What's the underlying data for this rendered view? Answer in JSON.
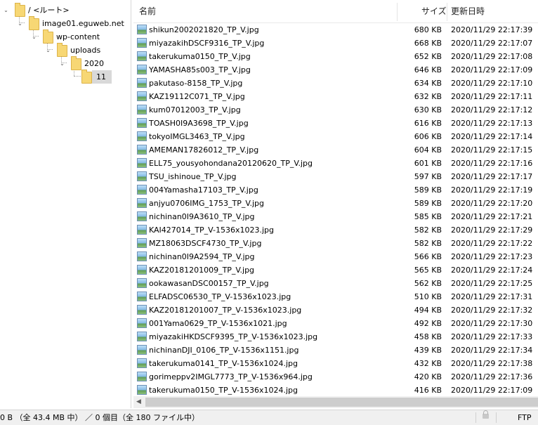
{
  "tree": [
    {
      "label": "/ <ルート>",
      "expanded": true,
      "selected": false
    },
    {
      "label": "image01.eguweb.net",
      "expanded": true,
      "selected": false
    },
    {
      "label": "wp-content",
      "expanded": true,
      "selected": false
    },
    {
      "label": "uploads",
      "expanded": true,
      "selected": false
    },
    {
      "label": "2020",
      "expanded": true,
      "selected": false
    },
    {
      "label": "11",
      "expanded": false,
      "selected": true
    }
  ],
  "columns": {
    "name": "名前",
    "size": "サイズ",
    "date": "更新日時"
  },
  "files": [
    {
      "name": "shikun2002021820_TP_V.jpg",
      "size": "680 KB",
      "date": "2020/11/29 22:17:39"
    },
    {
      "name": "miyazakihDSCF9316_TP_V.jpg",
      "size": "668 KB",
      "date": "2020/11/29 22:17:07"
    },
    {
      "name": "takerukuma0150_TP_V.jpg",
      "size": "652 KB",
      "date": "2020/11/29 22:17:08"
    },
    {
      "name": "YAMASHA85s003_TP_V.jpg",
      "size": "646 KB",
      "date": "2020/11/29 22:17:09"
    },
    {
      "name": "pakutaso-8158_TP_V.jpg",
      "size": "634 KB",
      "date": "2020/11/29 22:17:10"
    },
    {
      "name": "KAZ19112C071_TP_V.jpg",
      "size": "632 KB",
      "date": "2020/11/29 22:17:11"
    },
    {
      "name": "kum07012003_TP_V.jpg",
      "size": "630 KB",
      "date": "2020/11/29 22:17:12"
    },
    {
      "name": "TOASH0I9A3698_TP_V.jpg",
      "size": "616 KB",
      "date": "2020/11/29 22:17:13"
    },
    {
      "name": "tokyoIMGL3463_TP_V.jpg",
      "size": "606 KB",
      "date": "2020/11/29 22:17:14"
    },
    {
      "name": "AMEMAN17826012_TP_V.jpg",
      "size": "604 KB",
      "date": "2020/11/29 22:17:15"
    },
    {
      "name": "ELL75_yousyohondana20120620_TP_V.jpg",
      "size": "601 KB",
      "date": "2020/11/29 22:17:16"
    },
    {
      "name": "TSU_ishinoue_TP_V.jpg",
      "size": "597 KB",
      "date": "2020/11/29 22:17:17"
    },
    {
      "name": "004Yamasha17103_TP_V.jpg",
      "size": "589 KB",
      "date": "2020/11/29 22:17:19"
    },
    {
      "name": "anjyu0706IMG_1753_TP_V.jpg",
      "size": "589 KB",
      "date": "2020/11/29 22:17:20"
    },
    {
      "name": "nichinan0I9A3610_TP_V.jpg",
      "size": "585 KB",
      "date": "2020/11/29 22:17:21"
    },
    {
      "name": "KAI427014_TP_V-1536x1023.jpg",
      "size": "582 KB",
      "date": "2020/11/29 22:17:29"
    },
    {
      "name": "MZ18063DSCF4730_TP_V.jpg",
      "size": "582 KB",
      "date": "2020/11/29 22:17:22"
    },
    {
      "name": "nichinan0I9A2594_TP_V.jpg",
      "size": "566 KB",
      "date": "2020/11/29 22:17:23"
    },
    {
      "name": "KAZ20181201009_TP_V.jpg",
      "size": "565 KB",
      "date": "2020/11/29 22:17:24"
    },
    {
      "name": "ookawasanDSC00157_TP_V.jpg",
      "size": "562 KB",
      "date": "2020/11/29 22:17:25"
    },
    {
      "name": "ELFADSC06530_TP_V-1536x1023.jpg",
      "size": "510 KB",
      "date": "2020/11/29 22:17:31"
    },
    {
      "name": "KAZ20181201007_TP_V-1536x1023.jpg",
      "size": "494 KB",
      "date": "2020/11/29 22:17:32"
    },
    {
      "name": "001Yama0629_TP_V-1536x1021.jpg",
      "size": "492 KB",
      "date": "2020/11/29 22:17:30"
    },
    {
      "name": "miyazakiHKDSCF9395_TP_V-1536x1023.jpg",
      "size": "458 KB",
      "date": "2020/11/29 22:17:33"
    },
    {
      "name": "nichinanDJI_0106_TP_V-1536x1151.jpg",
      "size": "439 KB",
      "date": "2020/11/29 22:17:34"
    },
    {
      "name": "takerukuma0141_TP_V-1536x1024.jpg",
      "size": "432 KB",
      "date": "2020/11/29 22:17:38"
    },
    {
      "name": "gorimeppv2IMGL7773_TP_V-1536x964.jpg",
      "size": "420 KB",
      "date": "2020/11/29 22:17:36"
    },
    {
      "name": "takerukuma0150_TP_V-1536x1024.jpg",
      "size": "416 KB",
      "date": "2020/11/29 22:17:09"
    }
  ],
  "status": {
    "text": "0 B （全 43.4 MB 中） ／ 0 個目（全 180 ファイル中）",
    "protocol": "FTP"
  },
  "icons": {
    "tree_folder": "folder-icon",
    "file": "image-file-icon",
    "lock": "lock-icon"
  }
}
